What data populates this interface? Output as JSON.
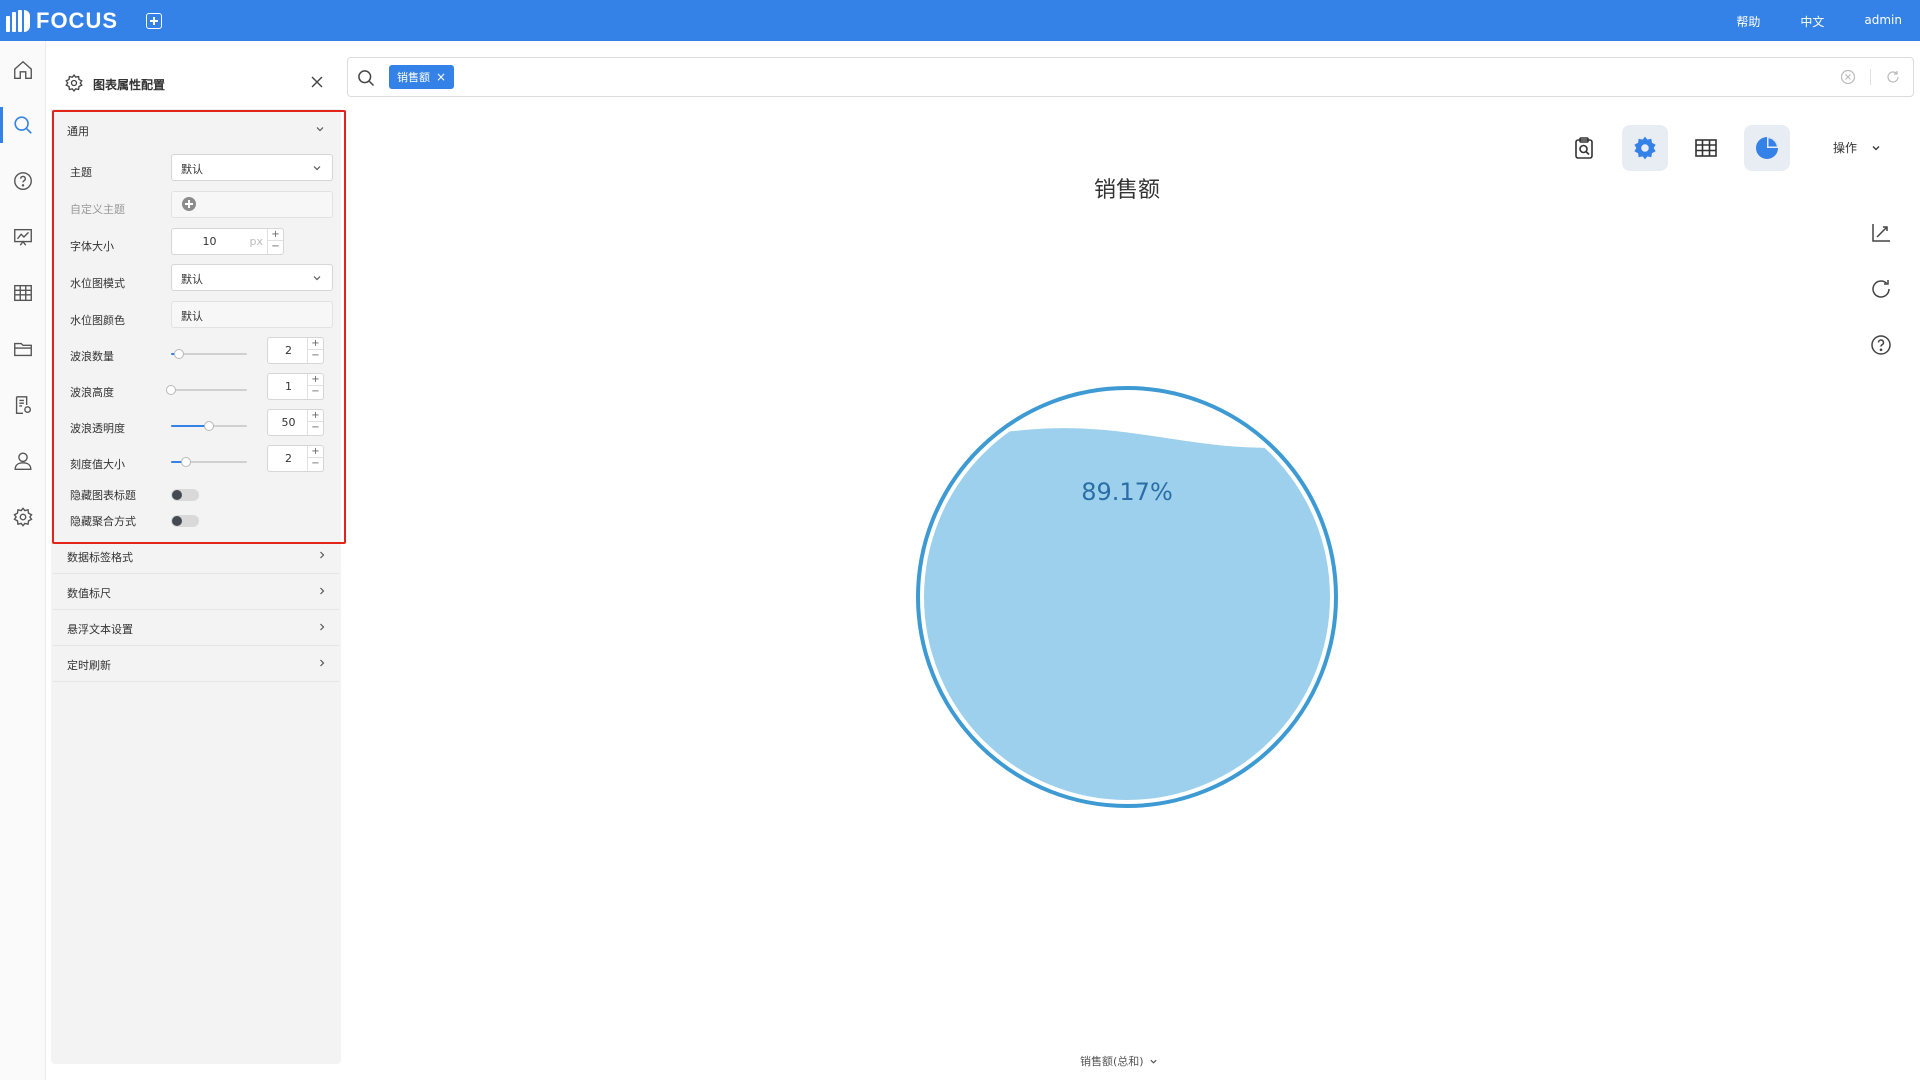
{
  "app": {
    "logo_text": "FOCUS"
  },
  "topbar": {
    "help": "帮助",
    "language": "中文",
    "user": "admin"
  },
  "nav": {
    "items": [
      "home-icon",
      "search-icon",
      "question-icon",
      "dashboard-icon",
      "table-icon",
      "folder-icon",
      "report-settings-icon",
      "user-icon",
      "gear-icon"
    ],
    "active_index": 1
  },
  "panel": {
    "title": "图表属性配置",
    "general": {
      "header": "通用",
      "theme_label": "主题",
      "theme_value": "默认",
      "custom_theme_label": "自定义主题",
      "font_size_label": "字体大小",
      "font_size_value": "10",
      "font_size_unit": "px",
      "water_style_label": "水位图模式",
      "water_style_value": "默认",
      "water_color_label": "水位图颜色",
      "water_color_value": "默认",
      "wave_count_label": "波浪数量",
      "wave_count_value": "2",
      "wave_height_label": "波浪高度",
      "wave_height_value": "1",
      "wave_opacity_label": "波浪透明度",
      "wave_opacity_value": "50",
      "tick_size_label": "刻度值大小",
      "tick_size_value": "2",
      "hide_title_label": "隐藏图表标题",
      "hide_agg_label": "隐藏聚合方式",
      "stepper_plus": "+",
      "stepper_minus": "−"
    },
    "sliders": {
      "wave_count": 0.1,
      "wave_height": 0.0,
      "wave_opacity": 0.5,
      "tick_size": 0.2
    },
    "collapsed": [
      "数据标签格式",
      "数值标尺",
      "悬浮文本设置",
      "定时刷新"
    ]
  },
  "search": {
    "chip": "销售额",
    "chip_close": "×"
  },
  "toolbar": {
    "ops_label": "操作"
  },
  "chart_data": {
    "type": "liquidfill",
    "title": "销售额",
    "value_label": "89.17%",
    "value": 0.8917,
    "footer": "销售额(总和)",
    "colors": {
      "fill": "#9dd0ec",
      "ring": "#3d9ad3",
      "text": "#2a6ea8"
    }
  },
  "colors": {
    "primary": "#3481e7",
    "highlight": "#e1251b"
  }
}
